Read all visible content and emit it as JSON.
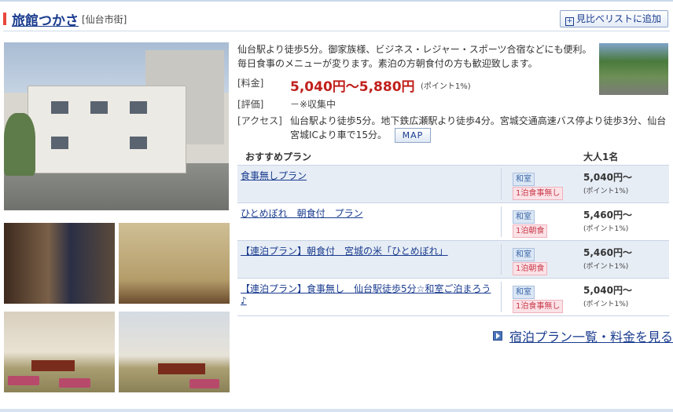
{
  "hotel": {
    "name": "旅館つかさ",
    "area": "[仙台市街]",
    "compare_button": "見比べリストに追加",
    "description": "仙台駅より徒歩5分。御家族様、ビジネス・レジャー・スポーツ合宿などにも便利。毎日食事のメニューが変ります。素泊の方朝食付の方も歓迎致します。",
    "labels": {
      "price": "[料金]",
      "review": "[評価]",
      "access": "[アクセス]"
    },
    "price": "5,040円〜5,880円",
    "price_point": "(ポイント1%)",
    "review": "－※収集中",
    "access": "仙台駅より徒歩5分。地下鉄広瀬駅より徒歩4分。宮城交通高速バス停より徒歩3分、仙台宮城ICより車で15分。",
    "map_button": "MAP"
  },
  "plans": {
    "header_plan": "おすすめプラン",
    "header_price": "大人1名",
    "items": [
      {
        "name": "食事無しプラン",
        "room": "和室",
        "meal": "1泊食事無し",
        "price": "5,040円〜",
        "point": "(ポイント1%)"
      },
      {
        "name": "ひとめぼれ　朝食付　プラン",
        "room": "和室",
        "meal": "1泊朝食",
        "price": "5,460円〜",
        "point": "(ポイント1%)"
      },
      {
        "name": "【連泊プラン】朝食付　宮城の米「ひとめぼれ」",
        "room": "和室",
        "meal": "1泊朝食",
        "price": "5,460円〜",
        "point": "(ポイント1%)"
      },
      {
        "name": "【連泊プラン】食事無し　仙台駅徒歩5分☆和室ご泊まろう♪",
        "room": "和室",
        "meal": "1泊食事無し",
        "price": "5,040円〜",
        "point": "(ポイント1%)"
      }
    ],
    "all_link": "宿泊プラン一覧・料金を見る"
  }
}
